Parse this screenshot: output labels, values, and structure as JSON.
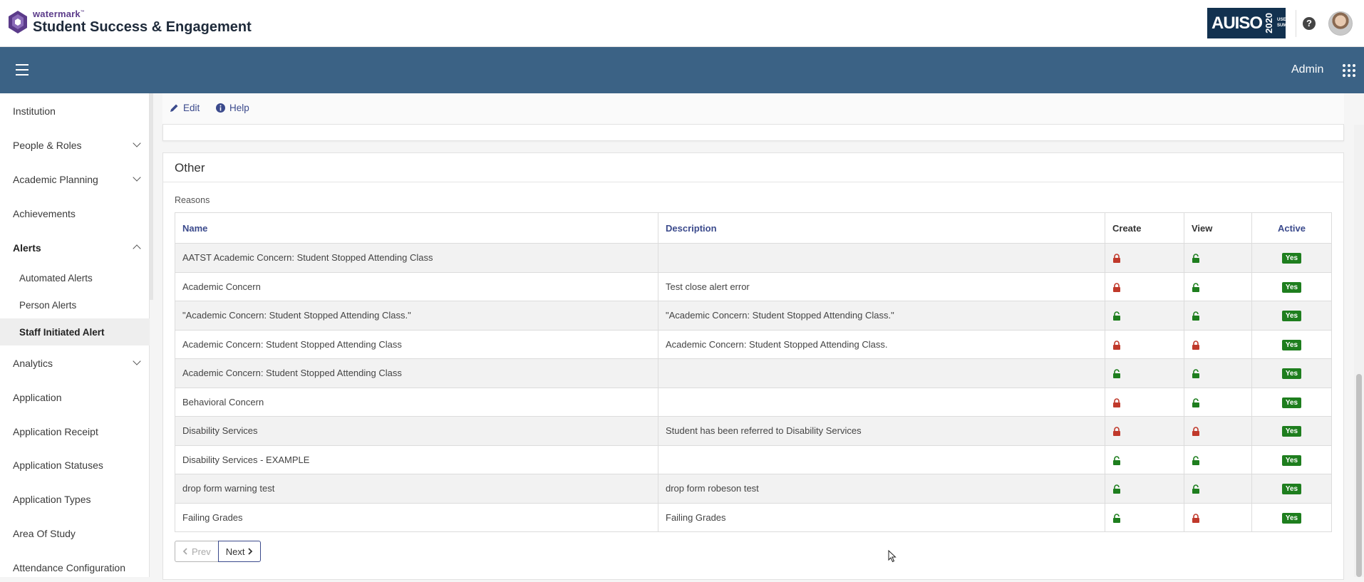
{
  "brand": {
    "small": "watermark",
    "tm": "™",
    "big": "Student Success & Engagement"
  },
  "summit": {
    "name": "AUISO",
    "year": "2020",
    "sub": "USER SUMMIT"
  },
  "nav": {
    "admin_label": "Admin"
  },
  "sidebar": {
    "items": [
      {
        "label": "Institution"
      },
      {
        "label": "People & Roles"
      },
      {
        "label": "Academic Planning"
      },
      {
        "label": "Achievements"
      },
      {
        "label": "Alerts"
      },
      {
        "label": "Automated Alerts"
      },
      {
        "label": "Person Alerts"
      },
      {
        "label": "Staff Initiated Alert"
      },
      {
        "label": "Analytics"
      },
      {
        "label": "Application"
      },
      {
        "label": "Application Receipt"
      },
      {
        "label": "Application Statuses"
      },
      {
        "label": "Application Types"
      },
      {
        "label": "Area Of Study"
      },
      {
        "label": "Attendance Configuration"
      }
    ]
  },
  "toolbar": {
    "edit_label": "Edit",
    "help_label": "Help"
  },
  "panel": {
    "title": "Other",
    "reasons_label": "Reasons",
    "columns": {
      "name": "Name",
      "description": "Description",
      "create": "Create",
      "view": "View",
      "active": "Active"
    },
    "rows": [
      {
        "name": "AATST Academic Concern: Student Stopped Attending Class",
        "description": "",
        "create": "locked",
        "view": "unlocked",
        "active": "Yes"
      },
      {
        "name": "Academic Concern",
        "description": "Test close alert error",
        "create": "locked",
        "view": "unlocked",
        "active": "Yes"
      },
      {
        "name": "\"Academic Concern: Student Stopped Attending Class.\"",
        "description": "\"Academic Concern: Student Stopped Attending Class.\"",
        "create": "unlocked",
        "view": "unlocked",
        "active": "Yes"
      },
      {
        "name": "Academic Concern: Student Stopped Attending Class",
        "description": "Academic Concern: Student Stopped Attending Class.",
        "create": "locked",
        "view": "locked",
        "active": "Yes"
      },
      {
        "name": "Academic Concern: Student Stopped Attending Class",
        "description": "",
        "create": "unlocked",
        "view": "unlocked",
        "active": "Yes"
      },
      {
        "name": "Behavioral Concern",
        "description": "",
        "create": "locked",
        "view": "unlocked",
        "active": "Yes"
      },
      {
        "name": "Disability Services",
        "description": "Student has been referred to Disability Services",
        "create": "locked",
        "view": "locked",
        "active": "Yes"
      },
      {
        "name": "Disability Services - EXAMPLE",
        "description": "",
        "create": "unlocked",
        "view": "unlocked",
        "active": "Yes"
      },
      {
        "name": "drop form warning test",
        "description": "drop form robeson test",
        "create": "unlocked",
        "view": "unlocked",
        "active": "Yes"
      },
      {
        "name": "Failing Grades",
        "description": "Failing Grades",
        "create": "unlocked",
        "view": "locked",
        "active": "Yes"
      }
    ],
    "pager": {
      "prev": "Prev",
      "next": "Next"
    }
  },
  "colors": {
    "lock_red": "#c0392b",
    "lock_green": "#1e7e1e",
    "nav_blue": "#3b6285",
    "link": "#3b4a8c",
    "yes_badge": "#1e7e1e"
  },
  "icons": {
    "edit": "pencil-icon",
    "help": "info-circle-icon",
    "lock": "padlock-icon",
    "apps": "grid-icon",
    "menu": "hamburger-icon"
  }
}
